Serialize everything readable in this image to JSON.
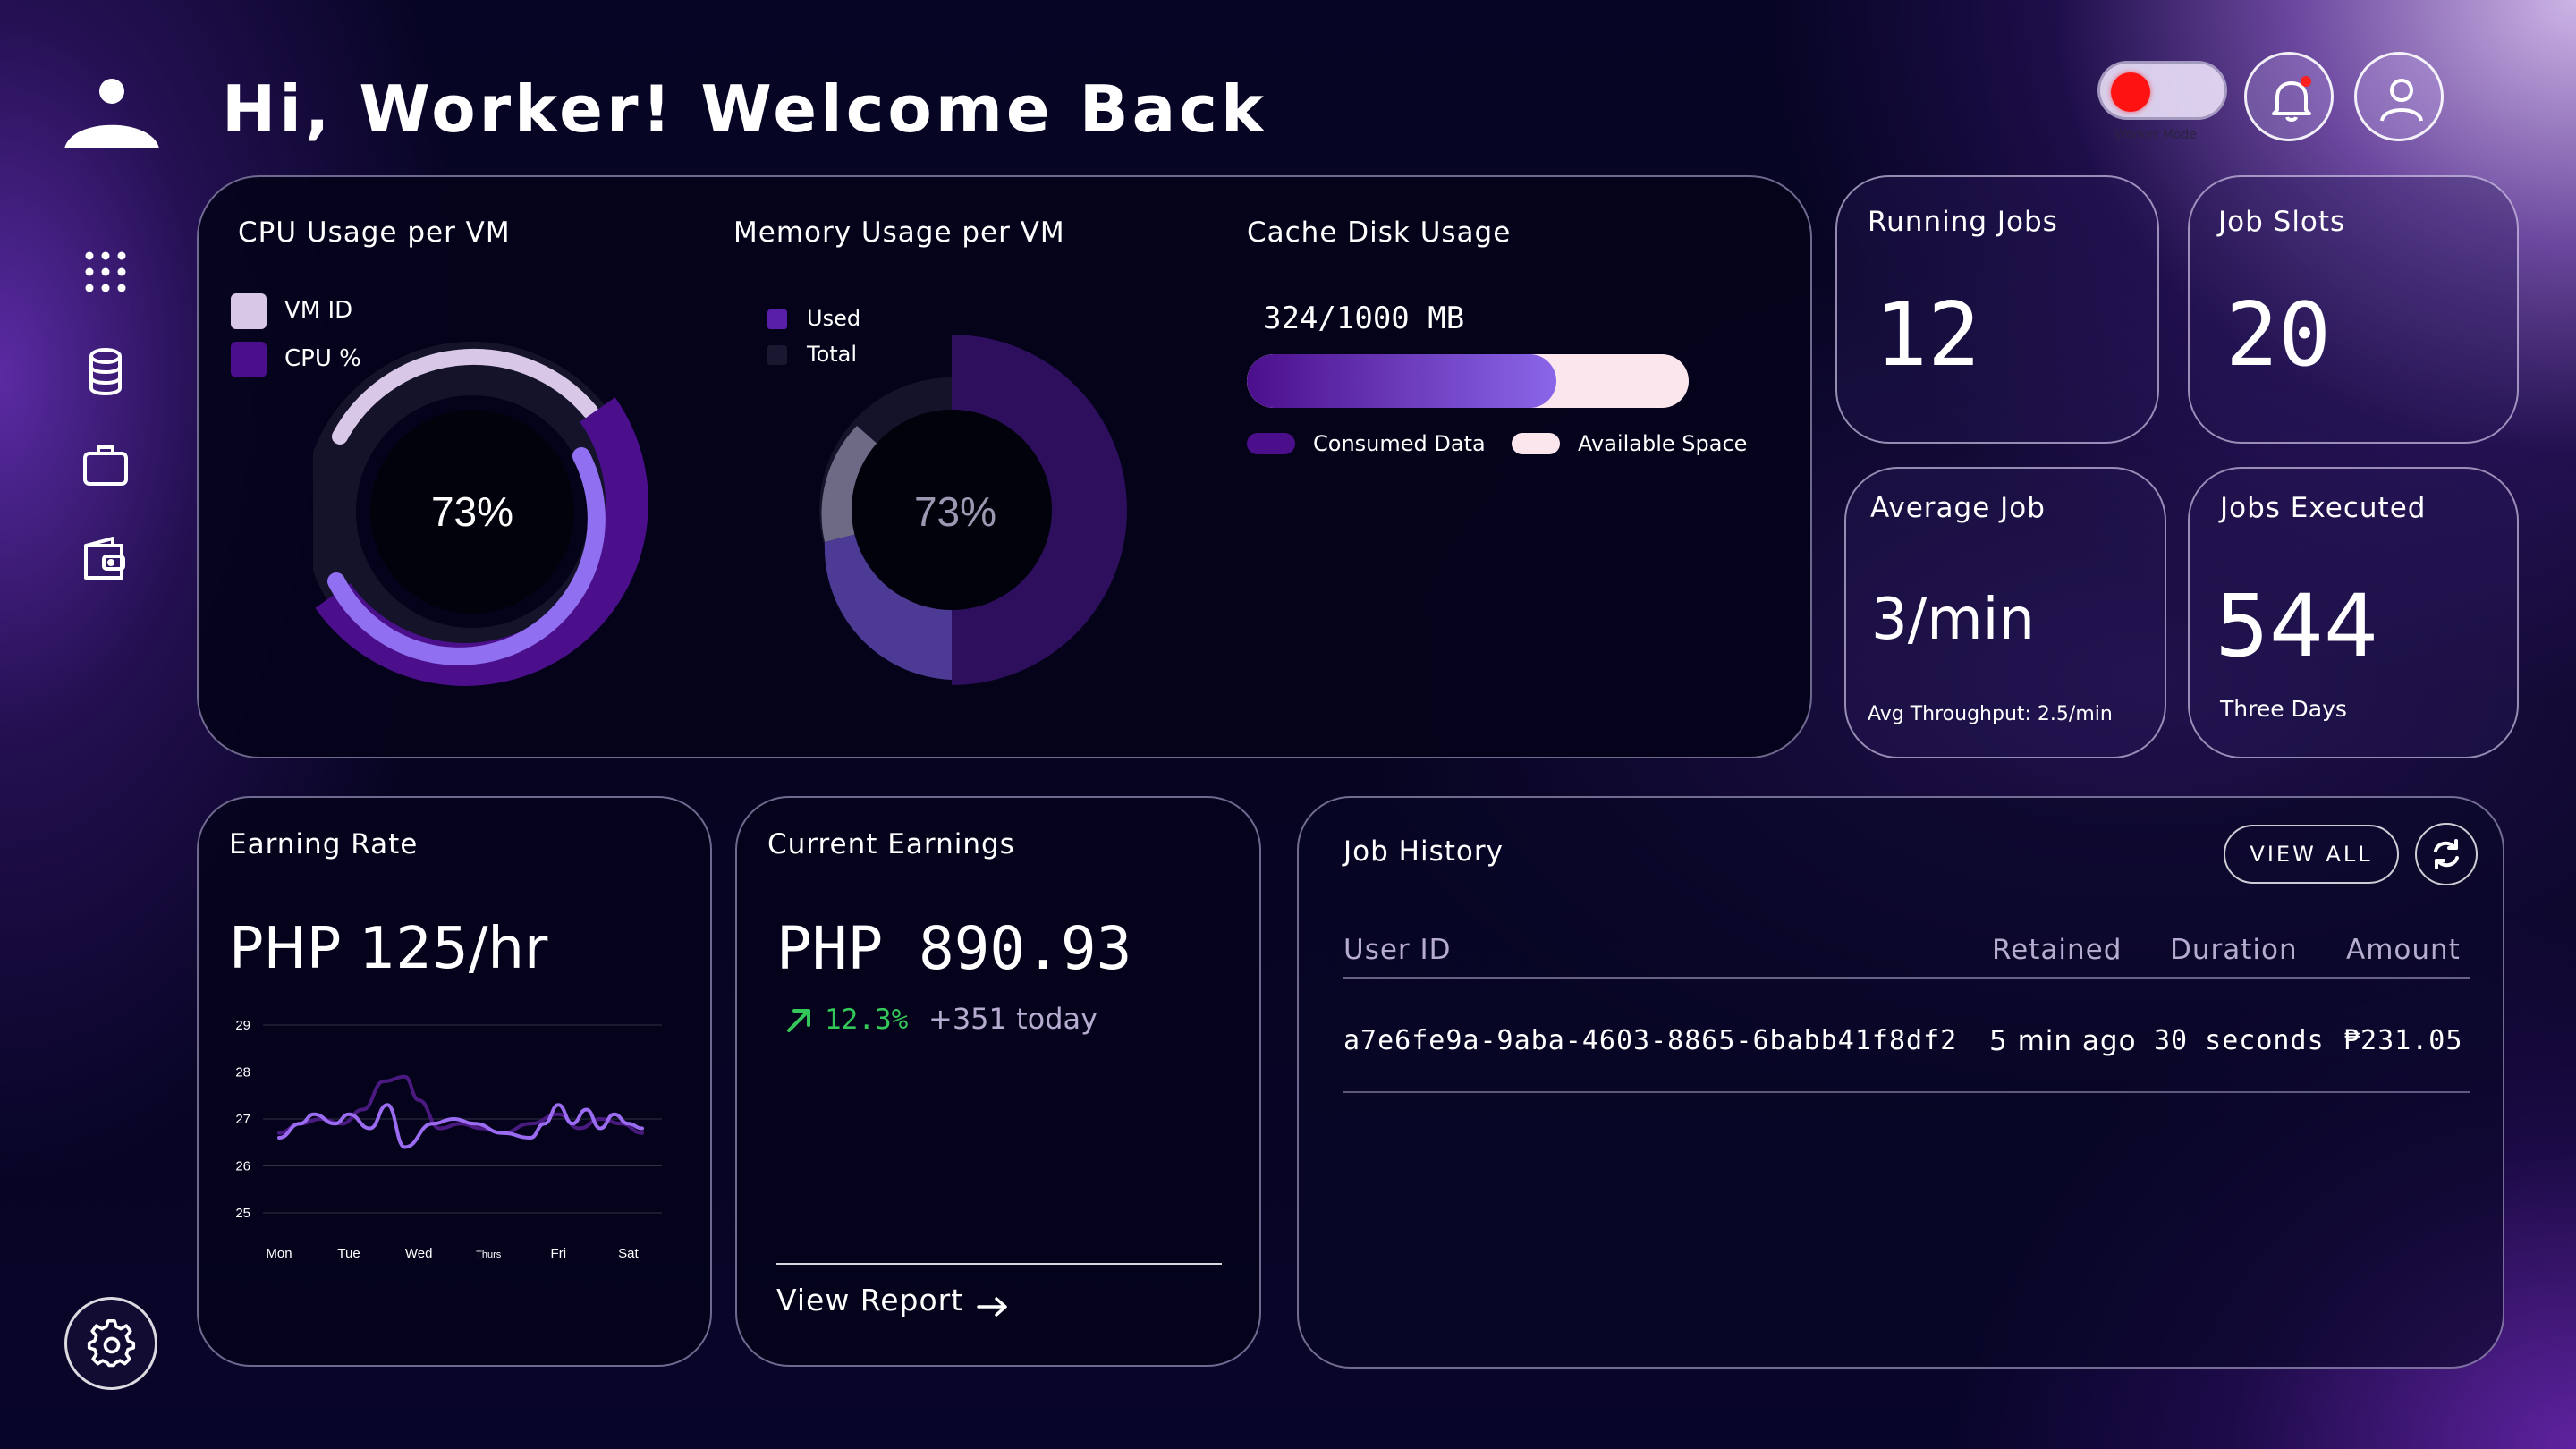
{
  "header": {
    "greeting": "Hi, Worker! Welcome Back",
    "toggle_label": "Worker Mode",
    "toggle_color": "#ff1212"
  },
  "sidebar": {
    "items": [
      {
        "name": "dashboard",
        "icon": "grid-icon"
      },
      {
        "name": "database",
        "icon": "database-icon"
      },
      {
        "name": "jobs",
        "icon": "briefcase-icon"
      },
      {
        "name": "wallet",
        "icon": "wallet-icon"
      }
    ],
    "settings_icon": "gear-icon"
  },
  "cpu": {
    "title": "CPU Usage per VM",
    "legend": [
      {
        "label": "VM ID",
        "color": "#d9c7e8"
      },
      {
        "label": "CPU %",
        "color": "#4b0f8c"
      }
    ],
    "value_label": "73%",
    "value": 73
  },
  "memory": {
    "title": "Memory Usage per VM",
    "legend": [
      {
        "label": "Used",
        "color": "#5a1fa8"
      },
      {
        "label": "Total",
        "color": "#1a1830"
      }
    ],
    "value_label": "73%",
    "value": 73
  },
  "cache": {
    "title": "Cache Disk Usage",
    "usage_label": "324/1000 MB",
    "used": 324,
    "total": 1000,
    "legend": [
      {
        "label": "Consumed Data",
        "color": "#4b0f8c"
      },
      {
        "label": "Available Space",
        "color": "#fce6ee"
      }
    ]
  },
  "stats": {
    "running_jobs": {
      "title": "Running Jobs",
      "value": "12"
    },
    "job_slots": {
      "title": "Job Slots",
      "value": "20"
    },
    "average_job": {
      "title": "Average Job",
      "value": "3/min",
      "sub": "Avg Throughput: 2.5/min"
    },
    "jobs_executed": {
      "title": "Jobs Executed",
      "value": "544",
      "sub": "Three Days"
    }
  },
  "earning_rate": {
    "title": "Earning Rate",
    "value": "PHP 125/hr"
  },
  "current_earnings": {
    "title": "Current Earnings",
    "value": "PHP 890.93",
    "change": "12.3%",
    "today": "+351 today",
    "report_link": "View Report"
  },
  "job_history": {
    "title": "Job History",
    "view_all": "VIEW ALL",
    "columns": [
      "User ID",
      "Retained",
      "Duration",
      "Amount"
    ],
    "rows": [
      [
        "a7e6fe9a-9aba-4603-8865-6babb41f8df2",
        "5 min ago",
        "30 seconds",
        "₱231.05"
      ]
    ]
  },
  "chart_data": {
    "type": "line",
    "categories": [
      "Mon",
      "Tue",
      "Wed",
      "Thurs",
      "Fri",
      "Sat"
    ],
    "yticks": [
      29,
      28,
      27,
      26,
      25
    ],
    "ylim": [
      25,
      29
    ],
    "series": [
      {
        "color": "#9b6cf2",
        "x": [
          0,
          0.3,
          0.5,
          0.8,
          1.0,
          1.3,
          1.55,
          1.8,
          2.2,
          2.5,
          2.8,
          3.2,
          3.6,
          3.8,
          4.0,
          4.2,
          4.4,
          4.6,
          4.8,
          5.0,
          5.2
        ],
        "values": [
          26.6,
          26.9,
          27.1,
          26.9,
          27.1,
          26.8,
          27.3,
          26.4,
          26.9,
          27.0,
          26.9,
          26.7,
          26.6,
          26.9,
          27.3,
          26.9,
          27.2,
          26.8,
          27.1,
          26.9,
          26.8
        ]
      },
      {
        "color": "#4a1a80",
        "x": [
          0,
          0.3,
          0.6,
          0.9,
          1.2,
          1.5,
          1.8,
          2.0,
          2.3,
          2.6,
          2.9,
          3.2,
          3.6,
          4.0,
          4.3,
          4.6,
          4.9,
          5.2
        ],
        "values": [
          26.7,
          26.9,
          27.0,
          26.9,
          27.2,
          27.8,
          27.9,
          27.4,
          26.8,
          26.9,
          26.8,
          26.7,
          26.9,
          27.1,
          26.8,
          27.0,
          26.9,
          26.7
        ]
      }
    ]
  }
}
